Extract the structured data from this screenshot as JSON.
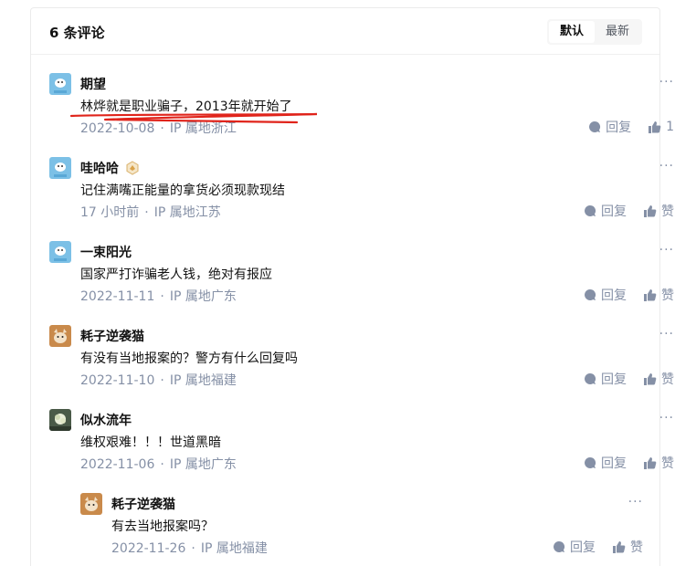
{
  "header": {
    "count_label": "6 条评论",
    "sort_default": "默认",
    "sort_newest": "最新"
  },
  "more_label": "···",
  "comments": [
    {
      "author": "期望",
      "content": "林烨就是职业骗子，2013年就开始了",
      "date": "2022-10-08",
      "ip": "IP 属地浙江",
      "reply_label": "回复",
      "like_label": "1"
    },
    {
      "author": "哇哈哈",
      "content": "记住满嘴正能量的拿货必须现款现结",
      "date": "17 小时前",
      "ip": "IP 属地江苏",
      "reply_label": "回复",
      "like_label": "赞"
    },
    {
      "author": "一束阳光",
      "content": "国家严打诈骗老人钱，绝对有报应",
      "date": "2022-11-11",
      "ip": "IP 属地广东",
      "reply_label": "回复",
      "like_label": "赞"
    },
    {
      "author": "耗子逆袭猫",
      "content": "有没有当地报案的？警方有什么回复吗",
      "date": "2022-11-10",
      "ip": "IP 属地福建",
      "reply_label": "回复",
      "like_label": "赞"
    },
    {
      "author": "似水流年",
      "content": "维权艰难！！！世道黑暗",
      "date": "2022-11-06",
      "ip": "IP 属地广东",
      "reply_label": "回复",
      "like_label": "赞"
    },
    {
      "author": "耗子逆袭猫",
      "content": "有去当地报案吗？",
      "date": "2022-11-26",
      "ip": "IP 属地福建",
      "reply_label": "回复",
      "like_label": "赞"
    }
  ],
  "colors": {
    "meta_text": "#8590a6",
    "annotation_red": "#e0241b"
  }
}
